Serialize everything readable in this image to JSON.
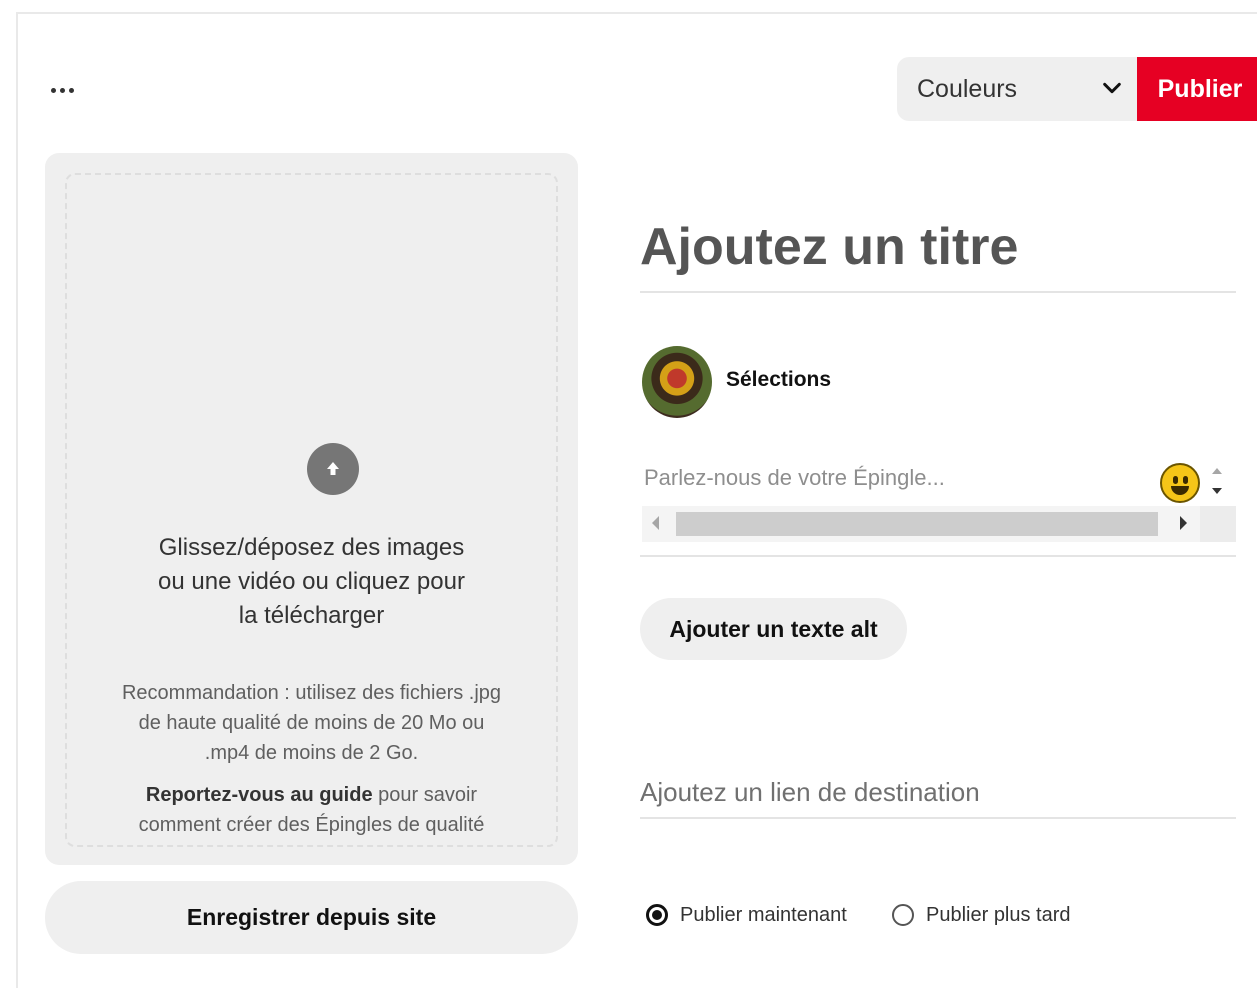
{
  "header": {
    "more_icon": "more-horizontal-icon",
    "board_select": {
      "value": "Couleurs"
    },
    "publish_label": "Publier",
    "accent_color": "#e60023"
  },
  "upload": {
    "icon": "arrow-up-circle-icon",
    "instructions": [
      "Glissez/déposez des images",
      "ou une vidéo ou cliquez pour",
      "la télécharger"
    ],
    "recommendation": [
      "Recommandation : utilisez des fichiers .jpg",
      "de haute qualité de moins de 20 Mo ou",
      ".mp4 de moins de 2 Go."
    ],
    "guide_link": "Reportez-vous au guide",
    "guide_text_1": " pour savoir",
    "guide_text_2": "comment créer des Épingles de qualité",
    "save_from_site": "Enregistrer depuis site"
  },
  "form": {
    "title_placeholder": "Ajoutez un titre",
    "profile_name": "Sélections",
    "description_placeholder": "Parlez-nous de votre Épingle...",
    "alt_text_button": "Ajouter un texte alt",
    "link_placeholder": "Ajoutez un lien de destination",
    "publish_options": [
      {
        "label": "Publier maintenant",
        "checked": true
      },
      {
        "label": "Publier plus tard",
        "checked": false
      }
    ]
  }
}
